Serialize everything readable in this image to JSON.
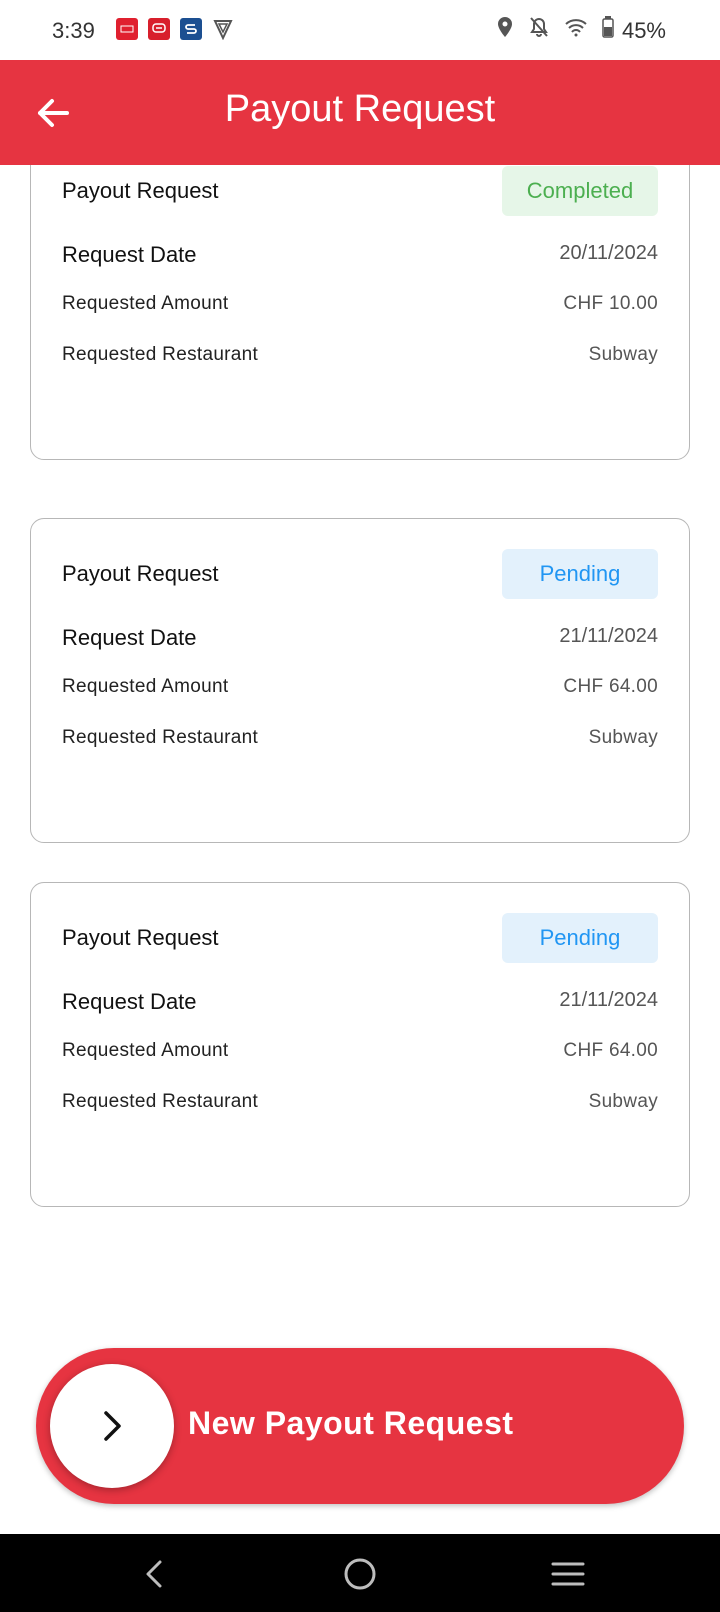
{
  "status_bar": {
    "time": "3:39",
    "battery": "45%",
    "notification_icons": [
      "app-icon-red",
      "app-icon-chat",
      "app-icon-s",
      "shield-icon"
    ],
    "system_icons": [
      "location-icon",
      "bell-off-icon",
      "wifi-icon",
      "battery-icon"
    ]
  },
  "app_bar": {
    "title": "Payout Request",
    "back_icon": "arrow-left-icon",
    "color": "#e63441"
  },
  "requests": [
    {
      "title": "Payout Request",
      "status": "Completed",
      "date_label": "Request Date",
      "date": "20/11/2024",
      "amount_label": "Requested Amount",
      "amount": "CHF 10.00",
      "restaurant_label": "Requested Restaurant",
      "restaurant": "Subway"
    },
    {
      "title": "Payout Request",
      "status": "Pending",
      "date_label": "Request Date",
      "date": "21/11/2024",
      "amount_label": "Requested Amount",
      "amount": "CHF 64.00",
      "restaurant_label": "Requested Restaurant",
      "restaurant": "Subway"
    },
    {
      "title": "Payout Request",
      "status": "Pending",
      "date_label": "Request Date",
      "date": "21/11/2024",
      "amount_label": "Requested Amount",
      "amount": "CHF 64.00",
      "restaurant_label": "Requested Restaurant",
      "restaurant": "Subway"
    }
  ],
  "cta": {
    "label": "New Payout Request",
    "icon": "chevron-right-icon"
  },
  "nav_bar": {
    "buttons": [
      "back-nav-icon",
      "home-nav-icon",
      "menu-nav-icon"
    ]
  },
  "colors": {
    "primary": "#e63441",
    "completed_text": "#4caf50",
    "completed_bg": "#e6f6e8",
    "pending_text": "#2196f3",
    "pending_bg": "#e3f1fc"
  }
}
